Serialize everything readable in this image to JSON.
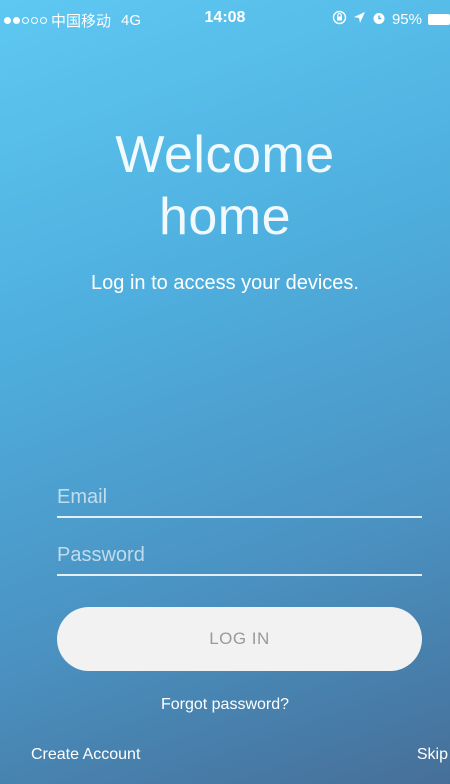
{
  "status_bar": {
    "carrier": "中国移动",
    "network": "4G",
    "time": "14:08",
    "battery_percent": "95%",
    "signal_bars_filled": 2,
    "signal_bars_total": 5,
    "icons": [
      "signal-dots-icon",
      "orientation-lock-icon",
      "location-arrow-icon",
      "alarm-icon",
      "battery-icon"
    ]
  },
  "hero": {
    "title_line1": "Welcome",
    "title_line2": "home",
    "subtitle": "Log in to access your devices."
  },
  "form": {
    "email_placeholder": "Email",
    "email_value": "",
    "password_placeholder": "Password",
    "password_value": "",
    "login_label": "LOG IN",
    "forgot_label": "Forgot password?"
  },
  "footer": {
    "create_account_label": "Create Account",
    "skip_label": "Skip"
  },
  "colors": {
    "gradient_top": "#5ec8f2",
    "gradient_bottom": "#466f98",
    "button_bg": "#f2f2f2",
    "button_text": "#9a9a9a"
  }
}
